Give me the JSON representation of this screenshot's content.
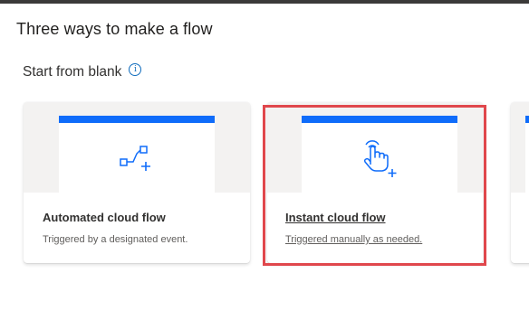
{
  "page": {
    "title": "Three ways to make a flow"
  },
  "section": {
    "title": "Start from blank",
    "info_icon": "info-icon"
  },
  "cards": [
    {
      "title": "Automated cloud flow",
      "description": "Triggered by a designated event.",
      "icon": "automated-flow-icon"
    },
    {
      "title": "Instant cloud flow",
      "description": "Triggered manually as needed.",
      "icon": "touch-hand-icon",
      "highlighted": true
    }
  ],
  "colors": {
    "accent": "#0f6cfa",
    "highlight": "#e0474c",
    "hero_background": "#f3f2f1"
  }
}
